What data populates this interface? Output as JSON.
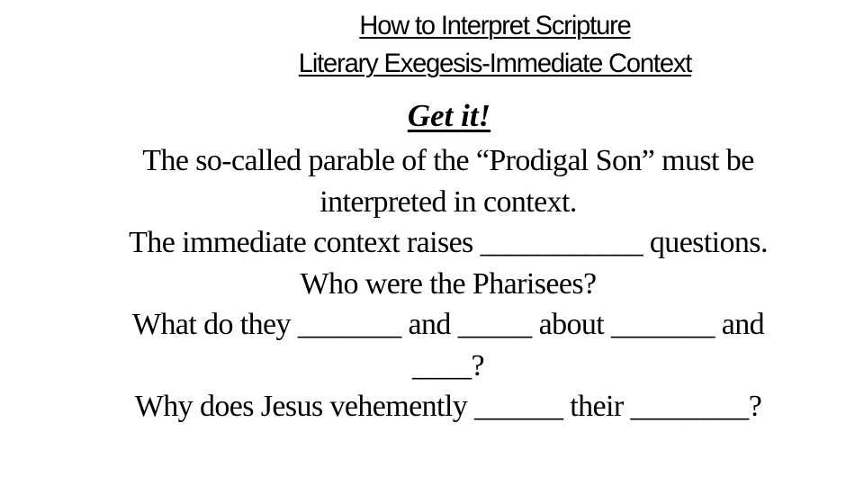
{
  "slide": {
    "title_lines": [
      "How to Interpret Scripture",
      "Literary Exegesis-Immediate Context"
    ],
    "subheading": "Get it!",
    "body_lines": [
      "The so-called parable of the “Prodigal Son” must be",
      "interpreted in context.",
      "The immediate context raises ___________ questions.",
      "Who were the Pharisees?",
      "What do they _______ and _____ about _______ and",
      "____?",
      "Why does Jesus vehemently ______ their ________?"
    ]
  }
}
